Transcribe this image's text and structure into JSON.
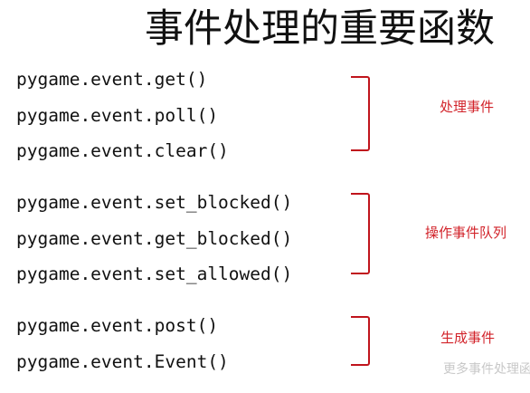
{
  "title": "事件处理的重要函数",
  "groups": [
    {
      "label": "处理事件",
      "functions": [
        "pygame.event.get()",
        "pygame.event.poll()",
        "pygame.event.clear()"
      ]
    },
    {
      "label": "操作事件队列",
      "functions": [
        "pygame.event.set_blocked()",
        "pygame.event.get_blocked()",
        "pygame.event.set_allowed()"
      ]
    },
    {
      "label": "生成事件",
      "functions": [
        "pygame.event.post()",
        "pygame.event.Event()"
      ]
    }
  ],
  "footer_text": "更多事件处理函",
  "colors": {
    "accent": "#d2232a",
    "bracket": "#c0141c"
  }
}
